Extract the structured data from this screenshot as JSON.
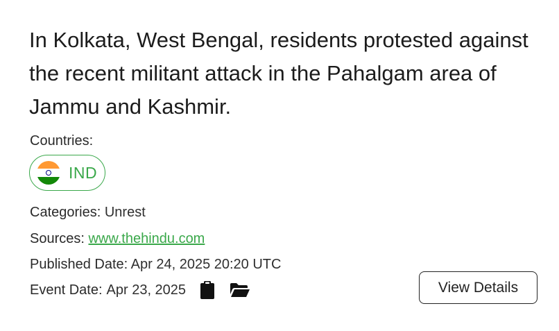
{
  "event": {
    "headline": "In Kolkata, West Bengal, residents protested against the recent militant attack in the Pahalgam area of Jammu and Kashmir.",
    "countries_label": "Countries:",
    "countries": [
      {
        "code": "IND",
        "flag_icon": "india-flag-icon"
      }
    ],
    "categories_label": "Categories:",
    "categories_value": "Unrest",
    "sources_label": "Sources:",
    "sources_value": "www.thehindu.com",
    "published_label": "Published Date:",
    "published_value": "Apr 24, 2025 20:20 UTC",
    "event_date_label": "Event Date:",
    "event_date_value": "Apr 23, 2025",
    "actions": {
      "copy_icon": "clipboard-icon",
      "open_icon": "folder-open-icon",
      "view_details_label": "View Details"
    }
  },
  "colors": {
    "accent": "#3aa84a",
    "text": "#1f1f1f",
    "border": "#222222"
  }
}
